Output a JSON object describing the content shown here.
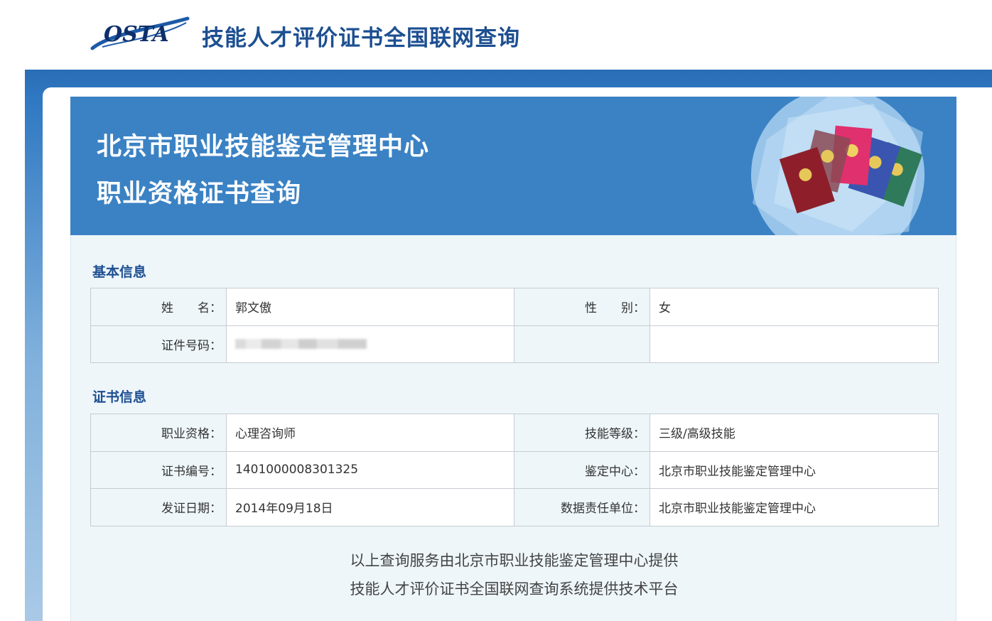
{
  "header": {
    "logo_text": "OSTA",
    "site_title": "技能人才评价证书全国联网查询"
  },
  "banner": {
    "line1": "北京市职业技能鉴定管理中心",
    "line2": "职业资格证书查询"
  },
  "basic_info": {
    "title": "基本信息",
    "name_label": "姓　　名：",
    "name_value": "郭文傲",
    "gender_label": "性　　别：",
    "gender_value": "女",
    "id_label": "证件号码："
  },
  "cert_info": {
    "title": "证书信息",
    "qualification_label": "职业资格：",
    "qualification_value": "心理咨询师",
    "level_label": "技能等级：",
    "level_value": "三级/高级技能",
    "cert_no_label": "证书编号：",
    "cert_no_value": "1401000008301325",
    "center_label": "鉴定中心：",
    "center_value": "北京市职业技能鉴定管理中心",
    "issue_date_label": "发证日期：",
    "issue_date_value": "2014年09月18日",
    "responsible_label": "数据责任单位：",
    "responsible_value": "北京市职业技能鉴定管理中心"
  },
  "footer": {
    "line1": "以上查询服务由北京市职业技能鉴定管理中心提供",
    "line2": "技能人才评价证书全国联网查询系统提供技术平台"
  }
}
